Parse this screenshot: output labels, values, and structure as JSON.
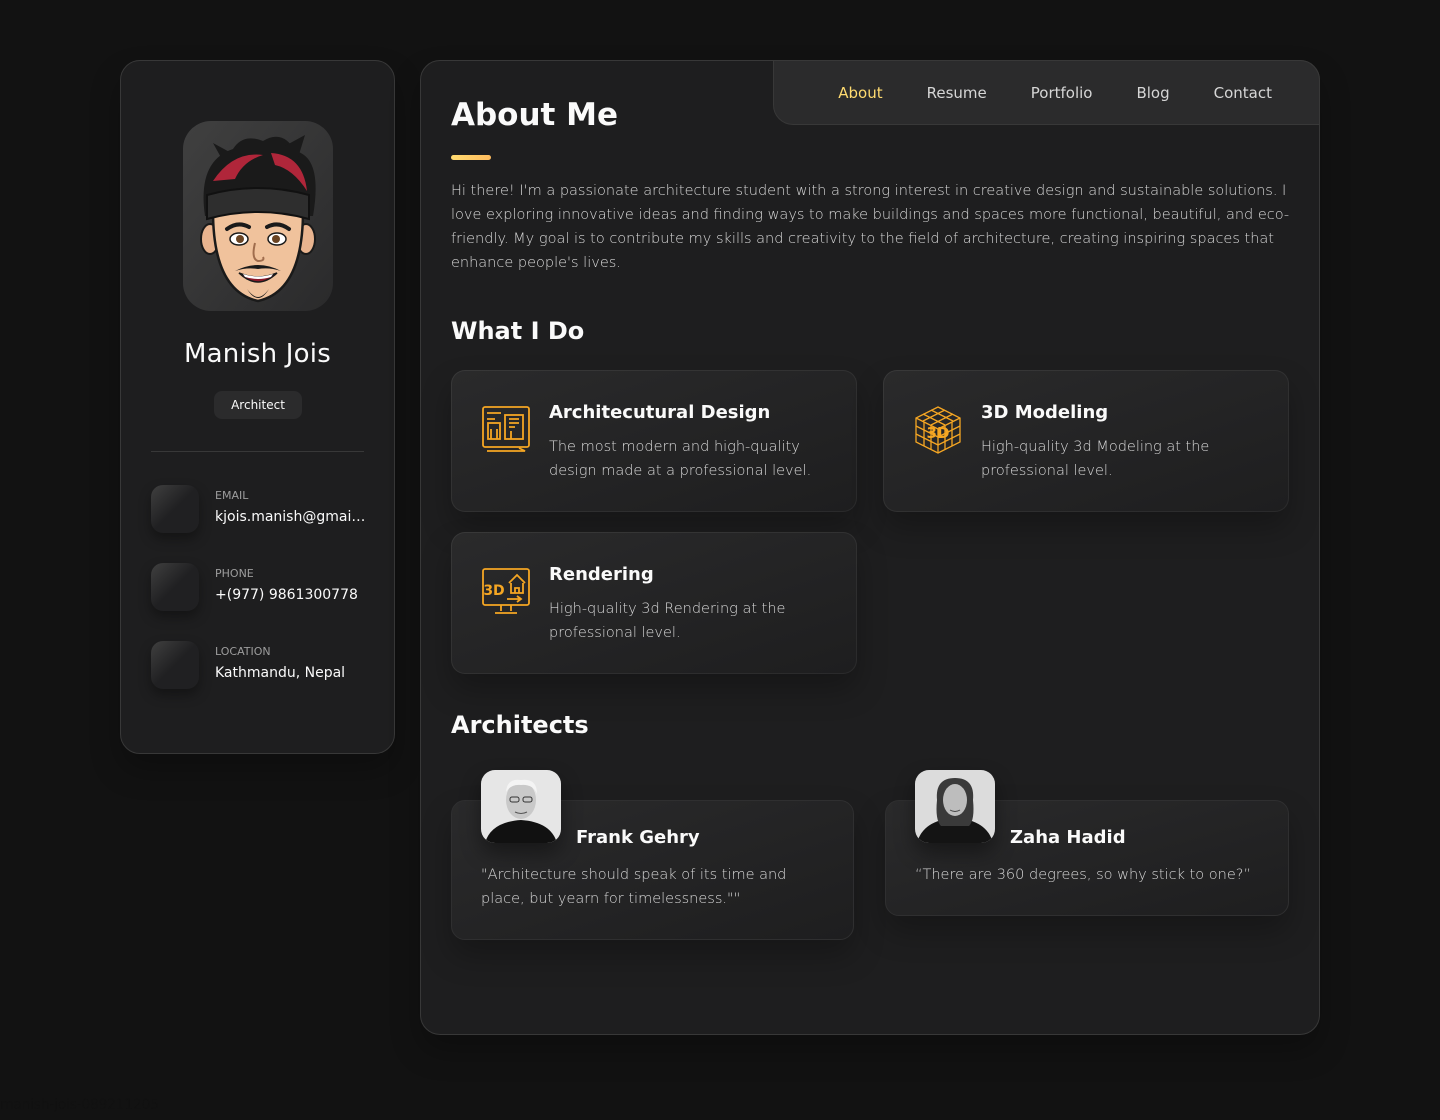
{
  "sidebar": {
    "name": "Manish Jois",
    "title": "Architect",
    "contacts": [
      {
        "label": "EMAIL",
        "value": "kjois.manish@gmail.com",
        "icon": "mail-icon"
      },
      {
        "label": "PHONE",
        "value": "+(977) 9861300778",
        "icon": "phone-icon"
      },
      {
        "label": "LOCATION",
        "value": "Kathmandu, Nepal",
        "icon": "location-icon"
      }
    ]
  },
  "nav": {
    "items": [
      "About",
      "Resume",
      "Portfolio",
      "Blog",
      "Contact"
    ],
    "active": "About"
  },
  "about": {
    "title": "About Me",
    "text": "Hi there! I'm a passionate architecture student with a strong interest in creative design and sustainable solutions. I love exploring innovative ideas and finding ways to make buildings and spaces more functional, beautiful, and eco-friendly. My goal is to contribute my skills and creativity to the field of architecture, creating inspiring spaces that enhance people's lives."
  },
  "services": {
    "title": "What I Do",
    "items": [
      {
        "title": "Architecutural Design",
        "desc": "The most modern and high-quality design made at a professional level.",
        "icon": "blueprint-icon"
      },
      {
        "title": "3D Modeling",
        "desc": "High-quality 3d Modeling at the professional level.",
        "icon": "3d-cube-icon"
      },
      {
        "title": "Rendering",
        "desc": "High-quality 3d Rendering at the professional level.",
        "icon": "3d-monitor-icon"
      }
    ]
  },
  "architects": {
    "title": "Architects",
    "items": [
      {
        "name": "Frank Gehry",
        "quote": "\"Architecture should speak of its time and place, but yearn for timelessness.\"\""
      },
      {
        "name": "Zaha Hadid",
        "quote": "“There are 360 degrees, so why stick to one?”"
      }
    ]
  },
  "footer": {
    "id": "manish-jois-089211205"
  },
  "colors": {
    "accent": "#ffdb70",
    "icon_orange": "#f5a623",
    "bg": "#121212",
    "card": "#1e1e1f"
  }
}
